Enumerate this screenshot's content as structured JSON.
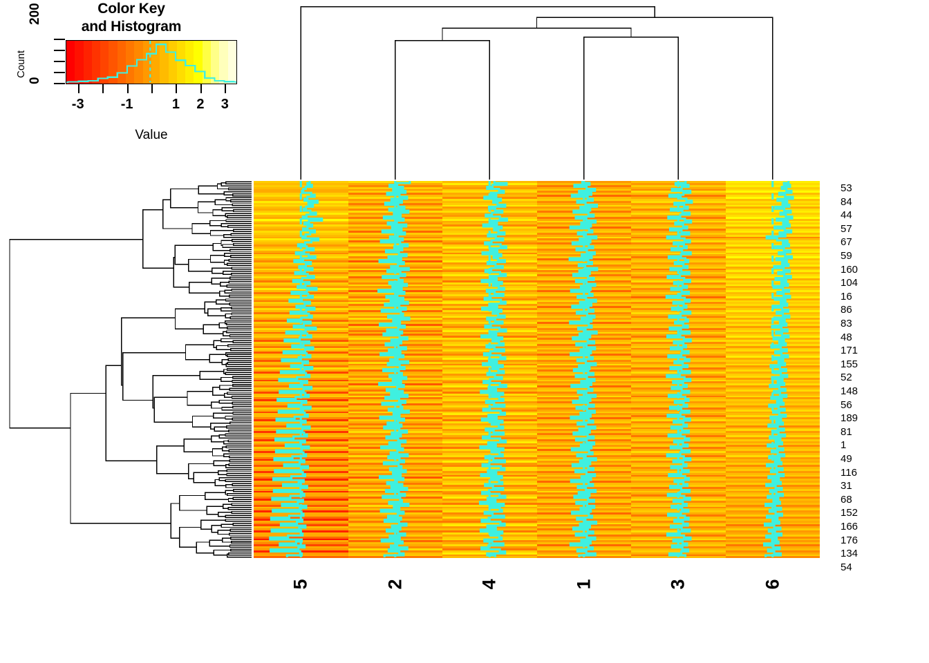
{
  "color_key": {
    "title_line1": "Color Key",
    "title_line2": "and Histogram",
    "y_axis_label": "Count",
    "y_ticks": [
      "0",
      "200"
    ],
    "x_axis_label": "Value",
    "x_tick_values": [
      -3,
      -2,
      -1,
      0,
      1,
      2,
      3
    ],
    "x_tick_labels": [
      "-3",
      "",
      "-1",
      "",
      "1",
      "2",
      "3"
    ],
    "palette": [
      "#ff0000",
      "#ff1100",
      "#ff2200",
      "#ff3300",
      "#ff4400",
      "#ff5500",
      "#ff6600",
      "#ff7700",
      "#ff8800",
      "#ff9900",
      "#ffaa00",
      "#ffbb00",
      "#ffcc00",
      "#ffdd00",
      "#ffee00",
      "#ffff00",
      "#ffff44",
      "#ffff88",
      "#ffffbb",
      "#ffffdd"
    ],
    "trace_color": "#3ff0e0",
    "histogram_bins": [
      -3.4,
      -3.0,
      -2.6,
      -2.2,
      -1.8,
      -1.4,
      -1.0,
      -0.6,
      -0.2,
      0.2,
      0.6,
      1.0,
      1.4,
      1.8,
      2.2,
      2.6,
      3.0,
      3.4
    ],
    "histogram_counts": [
      2,
      6,
      10,
      26,
      34,
      62,
      108,
      150,
      190,
      252,
      200,
      146,
      110,
      72,
      28,
      10,
      4
    ],
    "median_line_value": -0.05
  },
  "chart_data": {
    "type": "heatmap",
    "title": "Color Key and Histogram",
    "xlabel": "Value",
    "ylabel": "Count",
    "value_range": [
      -3.5,
      3.5
    ],
    "grid": false,
    "legend_position": "top-left",
    "column_labels": [
      "5",
      "2",
      "4",
      "1",
      "3",
      "6"
    ],
    "row_labels": [
      "53",
      "84",
      "44",
      "57",
      "67",
      "59",
      "160",
      "104",
      "16",
      "86",
      "83",
      "48",
      "171",
      "155",
      "52",
      "148",
      "56",
      "189",
      "81",
      "1",
      "49",
      "116",
      "31",
      "68",
      "152",
      "166",
      "176",
      "134",
      "54"
    ],
    "n_rows": 190,
    "n_cols": 6,
    "column_dendrogram": {
      "leaves": [
        "5",
        "2",
        "4",
        "1",
        "3",
        "6"
      ],
      "merges": [
        {
          "left": "2",
          "right": "4",
          "height": 0.78
        },
        {
          "left": "1",
          "right": "3",
          "height": 0.8
        },
        {
          "left": "(2,4)",
          "right": "(1,3)",
          "height": 0.85
        },
        {
          "left": "((2,4),(1,3))",
          "right": "6",
          "height": 0.91
        },
        {
          "left": "5",
          "right": "all",
          "height": 0.97
        }
      ]
    },
    "row_dendrogram": {
      "n_leaves": 190,
      "orientation": "left",
      "root_height": 1.0
    },
    "cell_values": {
      "5": [
        0.82,
        0.61,
        1.03,
        0.45,
        0.22,
        0.1,
        0.95,
        1.28,
        0.6,
        0.34,
        1.55,
        0.7,
        1.12,
        0.48,
        0.26,
        0.88,
        1.4,
        0.52,
        0.18,
        1.95,
        0.75,
        0.33,
        1.05,
        0.62,
        0.21,
        1.3,
        0.86,
        0.44,
        0.15,
        1.62,
        0.98,
        0.4,
        -0.25,
        0.55,
        1.18,
        0.3,
        -0.45,
        0.72,
        1.34,
        0.2,
        -0.6,
        0.92,
        0.46,
        -0.15,
        1.08,
        0.38,
        -0.52,
        0.64,
        1.22,
        0.12,
        -0.7,
        0.8,
        0.42,
        -0.3,
        1.45,
        0.56,
        -0.85,
        0.68,
        1.1,
        0.08,
        -1.05,
        0.84,
        0.36,
        -0.4,
        1.26,
        0.5,
        -0.95,
        0.74,
        1.02,
        0.05,
        -1.2,
        0.9,
        0.28,
        -0.65,
        1.38,
        0.44,
        -1.35,
        0.6,
        0.96,
        -0.1,
        -1.5,
        0.78,
        0.24,
        -0.8,
        1.14,
        0.4,
        -1.6,
        0.54,
        0.88,
        -0.2,
        -1.75,
        0.66,
        0.16,
        -0.9,
        1.06,
        0.32,
        -1.85,
        0.48,
        0.8,
        -0.35,
        -2.0,
        0.58,
        0.12,
        -1.0,
        0.98,
        0.26,
        -1.95,
        0.42,
        0.72,
        -0.48,
        -2.15,
        0.5,
        0.06,
        -1.15,
        0.9,
        0.2,
        -2.05,
        0.36,
        0.64,
        -0.58,
        -2.25,
        0.44,
        0.02,
        -1.25,
        0.82,
        0.14,
        -2.2,
        0.3,
        0.56,
        -0.68,
        -2.35,
        0.38,
        -0.05,
        -1.4,
        0.74,
        0.08,
        -2.3,
        0.24,
        0.48,
        -0.78,
        -2.45,
        0.32,
        -0.12,
        -1.55,
        0.66,
        0.02,
        -2.4,
        0.18,
        0.4,
        -0.88,
        -2.55,
        0.26,
        -0.2,
        -1.65,
        0.58,
        -0.04,
        -2.5,
        0.12,
        0.32,
        -0.98,
        -2.65,
        0.2,
        -0.28,
        -1.75,
        0.5,
        -0.1,
        -2.6,
        0.06,
        0.24,
        -1.08,
        -2.75,
        0.14,
        -0.36,
        -1.85,
        0.42,
        -0.16,
        -2.7,
        0.0,
        0.16,
        -1.18,
        -2.85,
        0.08,
        -0.44,
        -1.95,
        0.34,
        -0.22,
        -2.8,
        -0.06,
        0.08,
        -1.28
      ],
      "2": [
        1.35,
        0.18,
        -0.52,
        0.72,
        -0.18,
        0.95,
        -0.75,
        0.4,
        1.1,
        -0.35,
        0.62,
        -0.92,
        0.28,
        0.85,
        -0.55,
        1.22,
        -0.12,
        0.5,
        -1.05,
        0.78,
        0.15,
        -0.68,
        1.02,
        -0.28,
        0.58,
        -1.18,
        0.9,
        0.22,
        -0.48,
        0.7,
        -1.32,
        0.45,
        1.15,
        -0.08,
        0.65,
        -0.85,
        0.35,
        1.05,
        -0.62,
        0.55,
        -1.45,
        0.8,
        0.25,
        -0.38,
        1.25,
        -0.72,
        0.48,
        0.92,
        -1.15,
        0.32,
        0.68,
        -0.55,
        1.08,
        -0.25,
        0.6,
        -1.55,
        0.85,
        0.2,
        -0.82,
        0.75,
        -0.42,
        1.18,
        -0.95,
        0.38,
        0.98,
        -1.25,
        0.52,
        0.72,
        -0.65,
        1.3,
        -0.18,
        0.44,
        -1.42,
        0.88,
        0.28,
        -0.75,
        0.64,
        -1.08,
        0.4,
        1.12,
        -0.35,
        0.56,
        -0.88,
        0.3,
        1.0,
        -0.58,
        0.48,
        -1.35,
        0.76,
        0.22,
        -0.45,
        1.2,
        -0.68,
        0.42,
        0.86,
        -1.1,
        0.34,
        0.62,
        -0.52,
        1.02,
        -0.22,
        0.54,
        -1.48,
        0.8,
        0.18,
        -0.78,
        0.7,
        -0.38,
        1.14,
        -0.9,
        0.36,
        0.94,
        -1.2,
        0.5,
        0.66,
        -0.6,
        1.26,
        -0.15,
        0.4,
        -1.38,
        0.82,
        0.26,
        -0.7,
        0.58,
        -1.02,
        0.38,
        1.08,
        -0.32,
        0.52,
        -0.82,
        0.28,
        0.96,
        -0.54,
        0.44,
        -1.3,
        0.72,
        0.2,
        -0.42,
        1.16,
        -0.64,
        0.4,
        0.82,
        -1.05,
        0.32,
        0.58,
        -0.48,
        0.98,
        -0.2,
        0.5,
        -1.42,
        0.76,
        0.16,
        -0.74,
        0.66,
        -0.35,
        1.1,
        -0.85,
        0.34,
        0.9,
        -1.15,
        0.46,
        0.62,
        -0.56,
        1.22,
        -0.12,
        0.38,
        -1.32,
        0.78,
        0.24,
        -0.66,
        0.54,
        -0.98,
        0.36,
        1.04,
        -0.3,
        0.48,
        -0.78,
        0.26,
        0.92,
        -0.5,
        0.42,
        -1.25,
        0.68,
        0.18,
        -0.4,
        1.12,
        -0.6,
        0.38,
        0.78,
        -1.0
      ],
      "4": [
        0.45,
        1.58,
        0.28,
        -0.22,
        0.88,
        1.32,
        0.12,
        0.62,
        -0.48,
        1.05,
        0.35,
        0.75,
        1.45,
        -0.05,
        0.52,
        1.18,
        0.22,
        -0.35,
        0.95,
        1.62,
        0.08,
        0.68,
        -0.58,
        1.12,
        0.42,
        0.82,
        1.38,
        -0.15,
        0.58,
        1.25,
        0.18,
        -0.42,
        1.02,
        1.55,
        0.05,
        0.72,
        -0.65,
        1.08,
        0.38,
        0.78,
        1.42,
        -0.18,
        0.55,
        1.22,
        0.15,
        -0.38,
        0.98,
        1.5,
        0.02,
        0.65,
        -0.72,
        1.15,
        0.32,
        0.85,
        1.35,
        -0.25,
        0.48,
        1.28,
        0.1,
        -0.45,
        1.05,
        1.48,
        -0.02,
        0.7,
        -0.68,
        1.1,
        0.3,
        0.8,
        1.4,
        -0.22,
        0.52,
        1.2,
        0.12,
        -0.4,
        0.92,
        1.52,
        0.0,
        0.62,
        -0.75,
        1.18,
        0.28,
        0.88,
        1.3,
        -0.28,
        0.45,
        1.35,
        0.08,
        -0.5,
        1.0,
        1.45,
        -0.05,
        0.68,
        -0.62,
        1.22,
        0.25,
        0.82,
        1.32,
        -0.2,
        0.5,
        1.15,
        0.05,
        -0.55,
        0.95,
        1.55,
        -0.08,
        0.6,
        -0.8,
        1.25,
        0.22,
        0.9,
        1.28,
        -0.32,
        0.42,
        1.38,
        0.02,
        -0.58,
        1.02,
        1.42,
        -0.1,
        0.65,
        -0.7,
        1.2,
        0.2,
        0.85,
        1.25,
        -0.35,
        0.38,
        1.3,
        0.0,
        -0.62,
        0.98,
        1.5,
        -0.12,
        0.58,
        -0.85,
        1.28,
        0.18,
        0.92,
        1.22,
        -0.38,
        0.35,
        1.42,
        -0.02,
        -0.65,
        1.05,
        1.38,
        -0.15,
        0.62,
        -0.78,
        1.15,
        0.15,
        0.88,
        1.18,
        -0.42,
        0.32,
        1.25,
        -0.05,
        -0.68,
        0.92,
        1.46,
        -0.18,
        0.55,
        -0.88,
        1.32,
        0.12,
        0.95,
        1.15,
        -0.45,
        0.28,
        1.35,
        -0.08,
        -0.72,
        1.0,
        1.4,
        -0.2,
        0.58,
        -0.82,
        1.18,
        0.1,
        0.9,
        1.12,
        -0.48,
        0.25,
        1.28,
        -0.1,
        -0.75,
        0.95,
        1.44,
        -0.22,
        0.52
      ],
      "1": [
        -0.15,
        0.52,
        -0.88,
        0.25,
        1.02,
        -0.45,
        0.68,
        -1.12,
        0.35,
        0.82,
        -0.62,
        0.15,
        1.2,
        -0.32,
        0.58,
        -0.95,
        0.42,
        0.9,
        -0.75,
        0.22,
        1.08,
        -0.25,
        0.65,
        -1.25,
        0.48,
        0.78,
        -0.55,
        0.18,
        1.15,
        -0.38,
        0.6,
        -1.05,
        0.45,
        0.85,
        -0.68,
        0.28,
        1.0,
        -0.2,
        0.72,
        -1.32,
        0.4,
        0.75,
        -0.48,
        0.12,
        1.22,
        -0.42,
        0.55,
        -0.98,
        0.38,
        0.92,
        -0.72,
        0.25,
        1.05,
        -0.28,
        0.62,
        -1.18,
        0.5,
        0.8,
        -0.58,
        0.2,
        1.12,
        -0.35,
        0.68,
        -1.08,
        0.42,
        0.88,
        -0.65,
        0.3,
        0.98,
        -0.22,
        0.7,
        -1.28,
        0.45,
        0.72,
        -0.52,
        0.15,
        1.18,
        -0.4,
        0.58,
        -1.02,
        0.35,
        0.95,
        -0.7,
        0.24,
        1.02,
        -0.3,
        0.65,
        -1.22,
        0.48,
        0.82,
        -0.6,
        0.18,
        1.1,
        -0.45,
        0.52,
        -0.92,
        0.4,
        0.88,
        -0.75,
        0.28,
        0.98,
        -0.25,
        0.68,
        -1.15,
        0.42,
        0.78,
        -0.55,
        0.22,
        1.08,
        -0.38,
        0.6,
        -1.0,
        0.38,
        0.92,
        -0.68,
        0.3,
        1.0,
        -0.32,
        0.62,
        -1.2,
        0.45,
        0.85,
        -0.58,
        0.2,
        1.05,
        -0.42,
        0.55,
        -0.95,
        0.35,
        0.9,
        -0.72,
        0.26,
        0.95,
        -0.28,
        0.7,
        -1.12,
        0.48,
        0.8,
        -0.62,
        0.16,
        1.12,
        -0.35,
        0.58,
        -1.05,
        0.4,
        0.88,
        -0.78,
        0.24,
        1.02,
        -0.22,
        0.66,
        -1.18,
        0.44,
        0.84,
        -0.56,
        0.18,
        1.08,
        -0.48,
        0.52,
        -0.88,
        0.38,
        0.94,
        -0.7,
        0.3,
        0.96,
        -0.3,
        0.64,
        -1.1,
        0.46,
        0.76,
        -0.64,
        0.14,
        1.14,
        -0.36,
        0.56,
        -0.98,
        0.36,
        0.86,
        -0.74,
        0.28,
        1.04,
        -0.24,
        0.62,
        -1.24,
        0.42,
        0.82,
        -0.6,
        0.22,
        1.06,
        -0.44
      ],
      "3": [
        0.68,
        -0.25,
        0.95,
        0.32,
        -0.58,
        1.12,
        0.48,
        -0.82,
        0.22,
        0.75,
        1.25,
        -0.35,
        0.55,
        0.88,
        -0.68,
        0.38,
        1.05,
        0.18,
        -0.92,
        0.62,
        1.18,
        -0.28,
        0.45,
        0.82,
        -0.75,
        0.3,
        1.0,
        0.12,
        -1.02,
        0.58,
        1.08,
        -0.42,
        0.52,
        0.78,
        -0.62,
        0.35,
        1.15,
        0.25,
        -0.88,
        0.65,
        0.92,
        -0.32,
        0.48,
        0.85,
        -0.72,
        0.28,
        1.02,
        0.15,
        -0.98,
        0.55,
        1.1,
        -0.38,
        0.42,
        0.8,
        -0.65,
        0.32,
        0.98,
        0.2,
        -1.08,
        0.6,
        1.05,
        -0.45,
        0.5,
        0.75,
        -0.58,
        0.38,
        1.12,
        0.22,
        -0.85,
        0.68,
        0.9,
        -0.3,
        0.45,
        0.88,
        -0.78,
        0.25,
        1.05,
        0.18,
        -1.0,
        0.52,
        1.15,
        -0.4,
        0.48,
        0.72,
        -0.68,
        0.35,
        0.95,
        0.28,
        -0.92,
        0.62,
        1.02,
        -0.35,
        0.42,
        0.85,
        -0.72,
        0.3,
        1.08,
        0.15,
        -1.05,
        0.58,
        1.12,
        -0.48,
        0.45,
        0.78,
        -0.6,
        0.32,
        1.0,
        0.25,
        -0.88,
        0.65,
        0.95,
        -0.32,
        0.5,
        0.82,
        -0.75,
        0.28,
        1.02,
        0.2,
        -0.98,
        0.55,
        1.08,
        -0.42,
        0.48,
        0.8,
        -0.64,
        0.35,
        0.98,
        0.22,
        -0.9,
        0.6,
        1.0,
        -0.38,
        0.44,
        0.86,
        -0.7,
        0.3,
        1.05,
        0.18,
        -1.02,
        0.52,
        1.12,
        -0.45,
        0.46,
        0.76,
        -0.66,
        0.34,
        0.96,
        0.26,
        -0.86,
        0.64,
        0.98,
        -0.34,
        0.48,
        0.84,
        -0.74,
        0.28,
        1.04,
        0.16,
        -0.96,
        0.56,
        1.1,
        -0.44,
        0.42,
        0.78,
        -0.62,
        0.36,
        0.94,
        0.24,
        -0.94,
        0.62,
        0.96,
        -0.36,
        0.44,
        0.88,
        -0.68,
        0.32,
        1.06,
        0.14,
        -1.0,
        0.54,
        1.14,
        -0.46,
        0.4,
        0.82,
        -0.58,
        0.38,
        0.92,
        0.28,
        -0.82,
        0.66
      ],
      "6": [
        1.48,
        1.05,
        1.62,
        0.85,
        1.28,
        1.75,
        0.62,
        1.15,
        1.88,
        0.45,
        1.35,
        0.92,
        1.55,
        0.25,
        1.08,
        1.68,
        0.72,
        1.22,
        1.82,
        0.38,
        1.42,
        0.98,
        1.58,
        0.18,
        1.12,
        1.72,
        0.65,
        1.18,
        -0.55,
        0.42,
        1.38,
        0.95,
        1.52,
        0.22,
        1.05,
        1.65,
        0.58,
        1.15,
        1.78,
        0.35,
        1.32,
        0.88,
        1.48,
        0.15,
        1.02,
        1.58,
        0.52,
        1.08,
        1.7,
        0.28,
        1.25,
        0.82,
        1.42,
        0.08,
        0.95,
        1.52,
        0.45,
        1.02,
        1.62,
        0.22,
        1.18,
        0.75,
        1.35,
        0.02,
        0.88,
        1.45,
        0.38,
        0.95,
        1.55,
        0.15,
        1.12,
        0.68,
        1.28,
        -0.05,
        0.82,
        1.38,
        0.32,
        0.88,
        1.48,
        0.08,
        1.05,
        0.62,
        1.22,
        -0.12,
        0.75,
        1.32,
        0.25,
        0.82,
        1.42,
        0.02,
        0.98,
        0.55,
        1.15,
        -0.18,
        0.68,
        1.25,
        0.18,
        0.75,
        1.35,
        -0.05,
        0.92,
        0.48,
        1.08,
        -0.25,
        0.62,
        1.18,
        0.12,
        0.68,
        1.28,
        -0.12,
        0.85,
        0.42,
        1.02,
        -0.32,
        0.55,
        1.12,
        0.05,
        0.62,
        1.22,
        -0.18,
        0.78,
        0.35,
        0.95,
        -0.38,
        0.48,
        1.05,
        -0.02,
        0.55,
        1.15,
        -0.25,
        0.72,
        0.28,
        0.88,
        -0.45,
        0.42,
        0.98,
        -0.08,
        0.48,
        1.08,
        -0.32,
        0.65,
        0.22,
        0.82,
        -0.52,
        0.35,
        0.92,
        -0.15,
        0.42,
        1.02,
        -0.38,
        0.58,
        0.15,
        0.75,
        -0.58,
        0.28,
        0.85,
        -0.22,
        0.35,
        0.95,
        -0.45,
        0.52,
        0.08,
        0.68,
        -0.65,
        0.22,
        0.78,
        -0.28,
        0.28,
        0.88,
        -0.52,
        0.45,
        0.02,
        0.62,
        -0.72,
        0.15,
        0.72,
        -0.35,
        0.22,
        0.82,
        -0.58,
        0.38,
        -0.05,
        0.55,
        -0.78,
        0.08,
        0.65,
        -0.42,
        0.15,
        0.75,
        -0.65
      ]
    }
  }
}
